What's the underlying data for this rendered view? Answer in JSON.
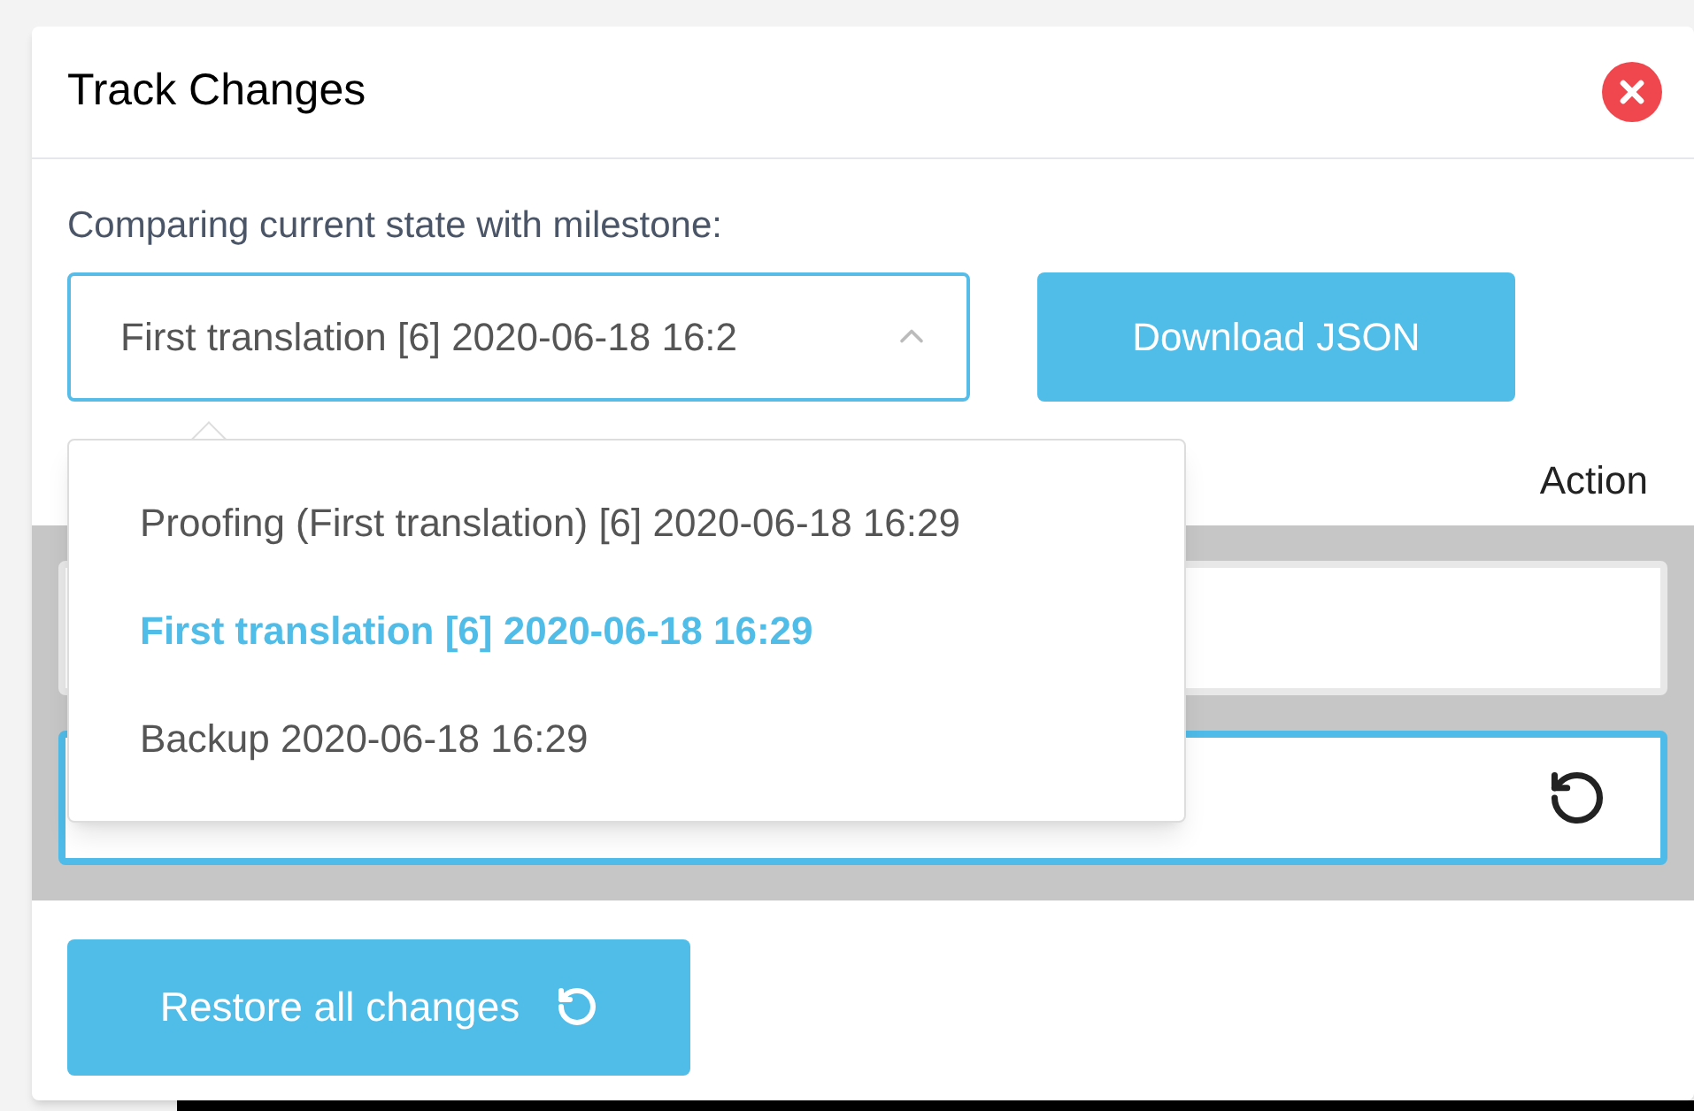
{
  "dialog": {
    "title": "Track Changes"
  },
  "milestone": {
    "label": "Comparing current state with milestone:",
    "value": "First translation [6] 2020-06-18 16:2",
    "expanded": true
  },
  "download_button": "Download JSON",
  "table": {
    "columns": [
      "Action"
    ],
    "rows": [
      {
        "selected": false
      },
      {
        "selected": true
      }
    ]
  },
  "dropdown_options": [
    {
      "label": "Proofing (First translation) [6] 2020-06-18 16:29",
      "selected": false
    },
    {
      "label": "First translation [6] 2020-06-18 16:29",
      "selected": true
    },
    {
      "label": "Backup 2020-06-18 16:29",
      "selected": false
    }
  ],
  "restore_button": "Restore all changes"
}
